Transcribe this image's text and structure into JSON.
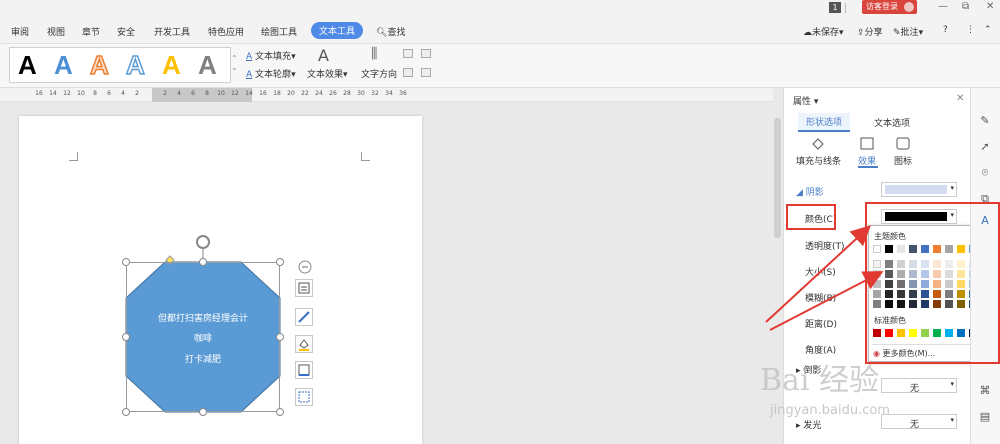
{
  "topbar": {
    "page_num": "1",
    "login": "访客登录",
    "minimize": "—",
    "restore": "⧉",
    "close": "✕"
  },
  "menu": {
    "items": [
      "审阅",
      "视图",
      "章节",
      "安全",
      "开发工具",
      "特色应用",
      "绘图工具",
      "文本工具"
    ],
    "active": "文本工具",
    "search": "查找",
    "unsaved": "未保存",
    "share": "分享",
    "comment": "批注",
    "help": "?",
    "more": "⋮"
  },
  "ribbon": {
    "gallery_letter": "A",
    "text_fill": "文本填充",
    "text_outline": "文本轮廓",
    "text_effect": "文本效果",
    "text_direction": "文字方向"
  },
  "ruler": {
    "ticks": [
      "16",
      "14",
      "12",
      "10",
      "8",
      "6",
      "4",
      "2",
      "",
      "2",
      "4",
      "6",
      "8",
      "10",
      "12",
      "14",
      "16",
      "18",
      "20",
      "22",
      "24",
      "26",
      "28",
      "30",
      "32",
      "34",
      "36"
    ]
  },
  "shape": {
    "lines": [
      "但都打扫害房经理会计",
      "咖啡",
      "打卡减肥"
    ],
    "fill": "#5b9bd5"
  },
  "panel": {
    "title": "属性",
    "tabs": [
      "形状选项",
      "文本选项"
    ],
    "subtabs": [
      "填充与线条",
      "效果",
      "图标"
    ],
    "shadow": "阴影",
    "color": "颜色(C)",
    "transparency": "透明度(T)",
    "size": "大小(S)",
    "blur": "模糊(B)",
    "distance": "距离(D)",
    "angle": "角度(A)",
    "reflection": "倒影",
    "glow": "发光",
    "none": "无",
    "color_value": "#000000"
  },
  "popup": {
    "theme_title": "主题颜色",
    "std_title": "标准颜色",
    "more": "更多颜色(M)...",
    "theme_top": [
      "#ffffff",
      "#000000",
      "#e7e6e6",
      "#44546a",
      "#4472c4",
      "#ed7d31",
      "#a5a5a5",
      "#ffc000",
      "#5b9bd5",
      "#70ad47"
    ],
    "theme_grid": [
      [
        "#f2f2f2",
        "#7f7f7f",
        "#d0cece",
        "#d6dce4",
        "#d9e2f3",
        "#fbe5d5",
        "#ededed",
        "#fff2cc",
        "#ddebf7",
        "#e2efd9"
      ],
      [
        "#d8d8d8",
        "#595959",
        "#aeabab",
        "#adb9ca",
        "#b4c6e7",
        "#f7cbac",
        "#dbdbdb",
        "#fee599",
        "#bdd7ee",
        "#c5e0b3"
      ],
      [
        "#bfbfbf",
        "#3f3f3f",
        "#757070",
        "#8496b0",
        "#8eaadb",
        "#f4b183",
        "#c9c9c9",
        "#ffd965",
        "#9dc3e6",
        "#a8d08d"
      ],
      [
        "#a5a5a5",
        "#262626",
        "#3a3838",
        "#323f4f",
        "#2f5496",
        "#c55a11",
        "#7b7b7b",
        "#bf9000",
        "#2e75b5",
        "#538135"
      ],
      [
        "#7f7f7f",
        "#0c0c0c",
        "#171616",
        "#222a35",
        "#1f3864",
        "#833c0b",
        "#525252",
        "#7f6000",
        "#1e4e79",
        "#375623"
      ]
    ],
    "standard": [
      "#c00000",
      "#ff0000",
      "#ffc000",
      "#ffff00",
      "#92d050",
      "#00b050",
      "#00b0f0",
      "#0070c0",
      "#002060",
      "#7030a0"
    ]
  },
  "watermark": {
    "brand": "Bai 经验",
    "url": "jingyan.baidu.com"
  }
}
